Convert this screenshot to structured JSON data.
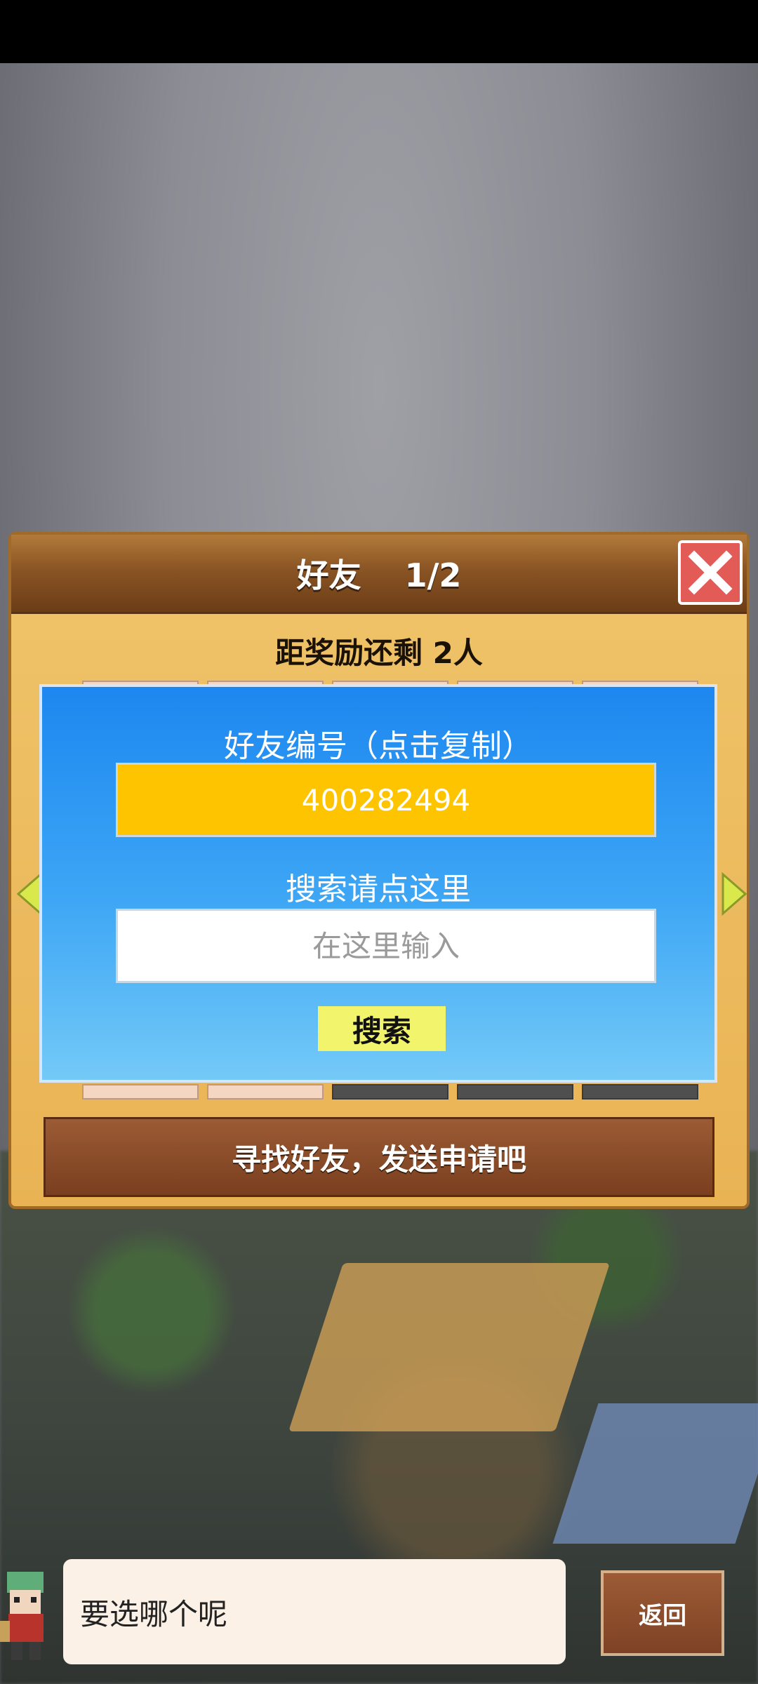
{
  "dialog": {
    "title": "好友　 1/2",
    "reward_text": "距奖励还剩 2人",
    "send_button_label": "寻找好友，发送申请吧"
  },
  "panel": {
    "friend_id_label": "好友编号（点击复制）",
    "friend_id_value": "400282494",
    "search_label": "搜索请点这里",
    "search_placeholder": "在这里输入",
    "search_button_label": "搜索"
  },
  "footer": {
    "speech_text": "要选哪个呢",
    "back_button_label": "返回"
  },
  "colors": {
    "accent_yellow": "#ffc400",
    "panel_blue": "#1d87f0",
    "close_red": "#e35b57",
    "button_brown": "#7a3f20"
  },
  "icons": {
    "close": "close-icon",
    "left_arrow": "arrow-left-icon",
    "right_arrow": "arrow-right-icon",
    "avatar": "character-avatar"
  }
}
